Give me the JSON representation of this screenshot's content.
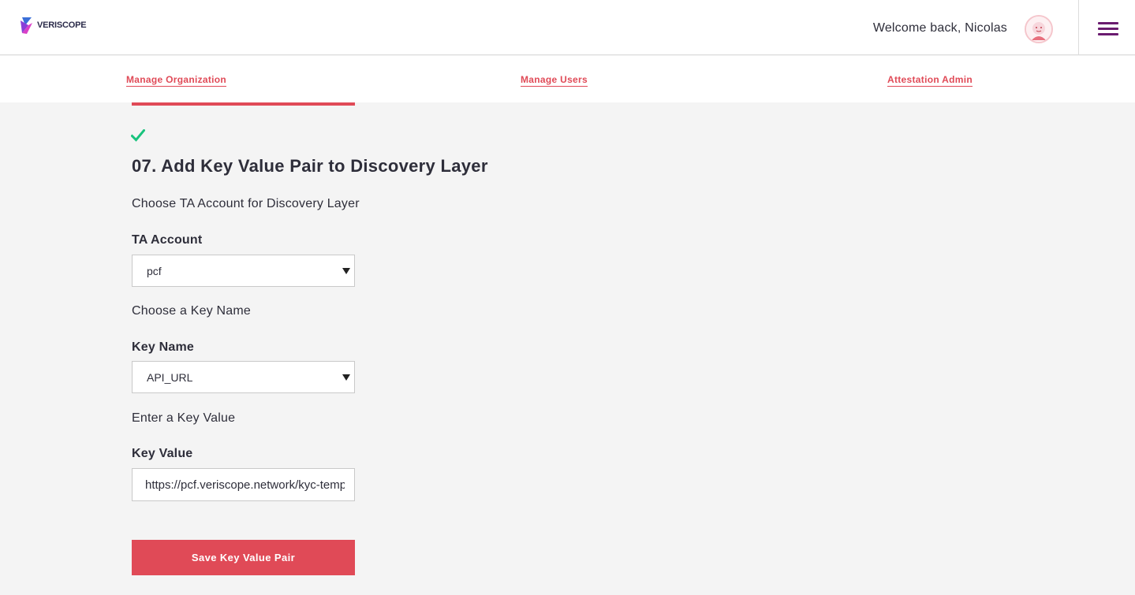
{
  "header": {
    "logo_text": "VERISCOPE",
    "welcome_text": "Welcome back, Nicolas",
    "menu_icon": "hamburger-menu-icon",
    "accent_color": "#6a1b6f"
  },
  "subnav": {
    "items": [
      {
        "label": "Manage Organization"
      },
      {
        "label": "Manage Users"
      },
      {
        "label": "Attestation Admin"
      }
    ],
    "link_color": "#e04a57"
  },
  "main": {
    "status_icon": "check-icon",
    "status_color": "#19c37d",
    "section_title": "07. Add Key Value Pair to Discovery Layer",
    "ta_instruction": "Choose TA Account for Discovery Layer",
    "ta_label": "TA Account",
    "ta_selected": "pcf",
    "key_instruction": "Choose a Key Name",
    "key_label": "Key Name",
    "key_selected": "API_URL",
    "value_instruction": "Enter a Key Value",
    "value_label": "Key Value",
    "value_input": "https://pcf.veriscope.network/kyc-template",
    "save_label": "Save Key Value Pair",
    "button_color": "#e04a57"
  }
}
